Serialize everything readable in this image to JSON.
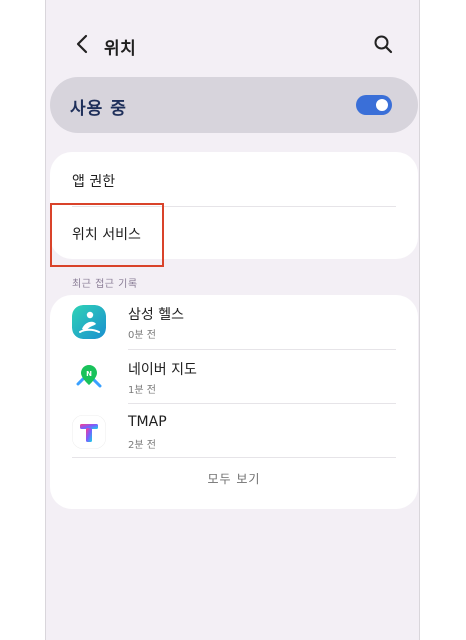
{
  "header": {
    "title": "위치",
    "back_icon": "chevron-left-icon",
    "search_icon": "search-icon"
  },
  "master_switch": {
    "label": "사용 중",
    "state": "on",
    "accent_color": "#3a6fd8"
  },
  "settings": {
    "items": [
      {
        "label": "앱 권한"
      },
      {
        "label": "위치 서비스"
      }
    ],
    "highlight_color": "#d9432a"
  },
  "recent_access": {
    "section_title": "최근 접근 기록",
    "apps": [
      {
        "name": "삼성 헬스",
        "time": "0분 전",
        "icon": "samsung-health-icon"
      },
      {
        "name": "네이버 지도",
        "time": "1분 전",
        "icon": "naver-map-icon"
      },
      {
        "name": "TMAP",
        "time": "2분 전",
        "icon": "tmap-icon"
      }
    ],
    "view_all_label": "모두 보기"
  }
}
